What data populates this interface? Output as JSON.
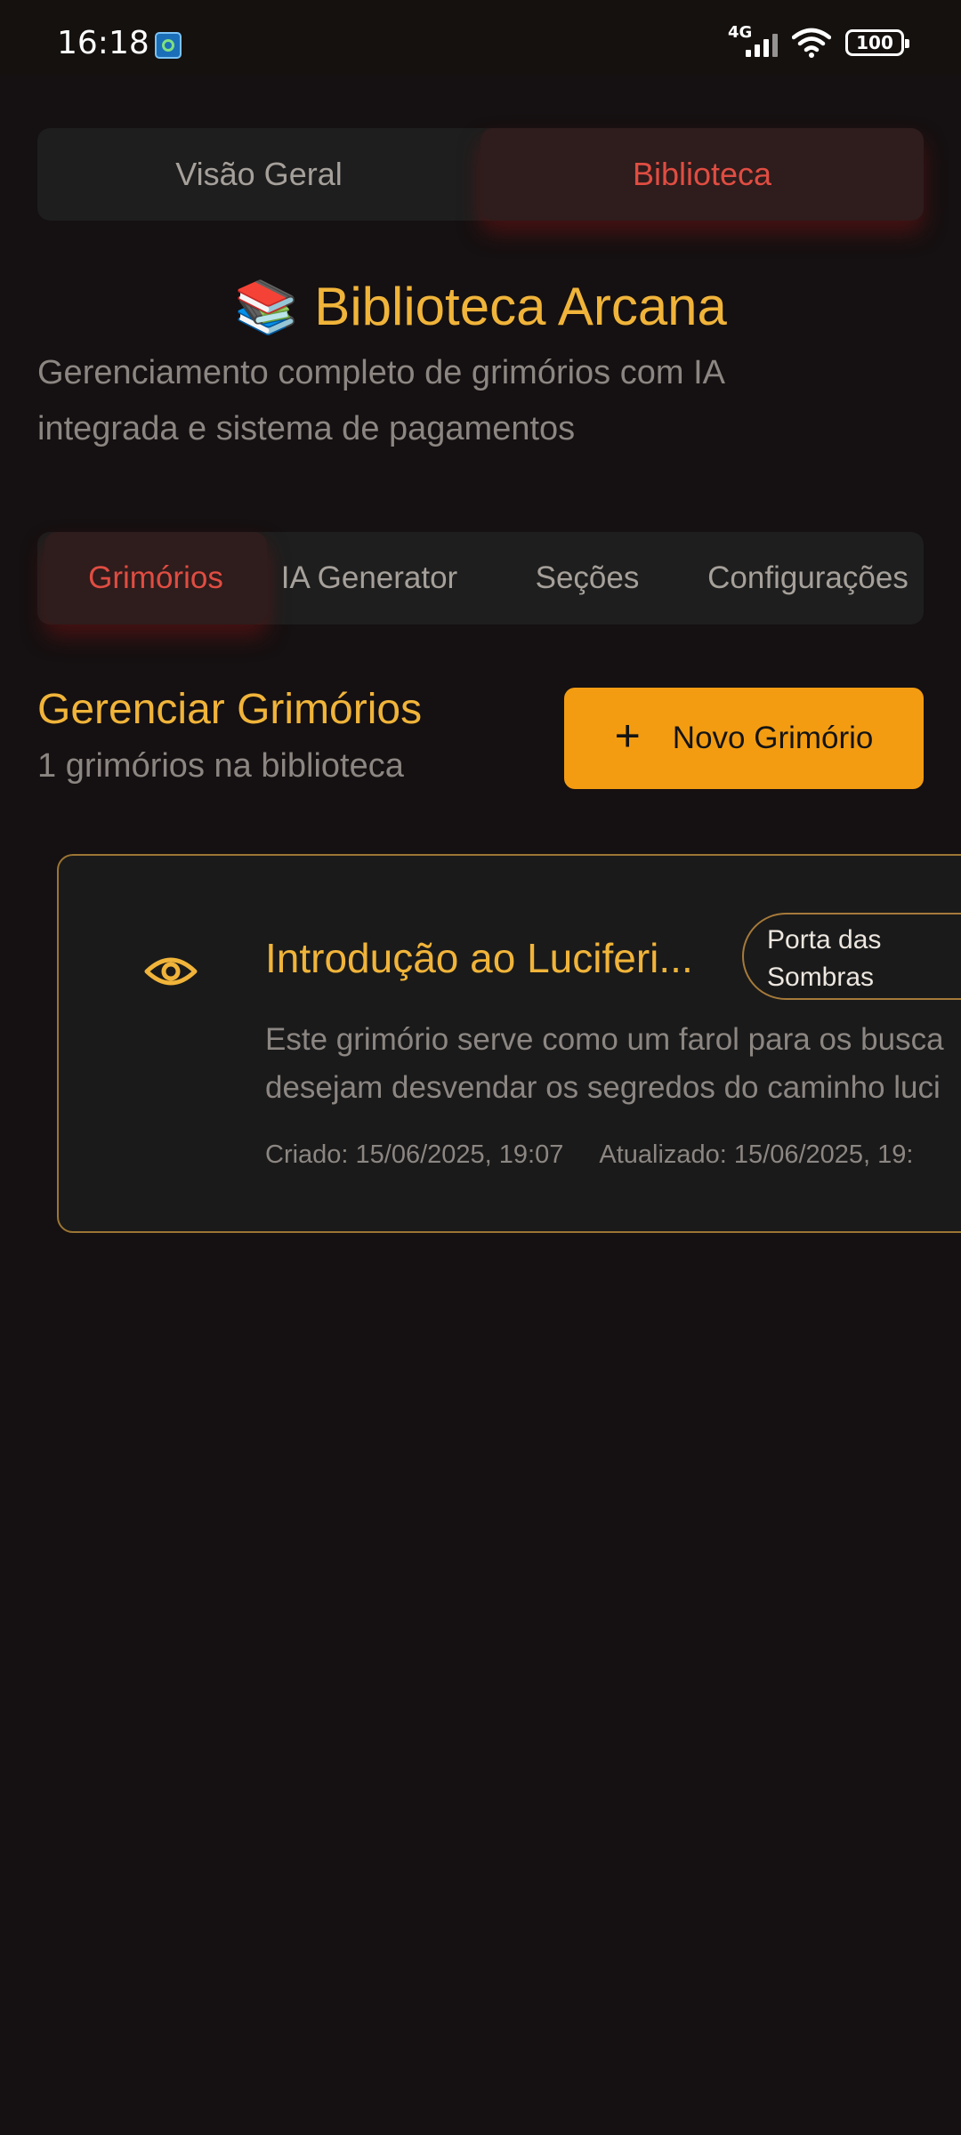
{
  "status_bar": {
    "time": "16:18",
    "network": "4G",
    "battery": "100"
  },
  "top_nav": {
    "tabs": [
      {
        "label": "Visão Geral",
        "active": false
      },
      {
        "label": "Biblioteca",
        "active": true
      }
    ]
  },
  "header": {
    "icon": "📚",
    "title": "Biblioteca Arcana",
    "subtitle_line1": "Gerenciamento completo de grimórios com IA",
    "subtitle_line2": "integrada e sistema de pagamentos"
  },
  "sub_tabs": [
    {
      "label": "Grimórios",
      "active": true
    },
    {
      "label": "IA Generator",
      "active": false
    },
    {
      "label": "Seções",
      "active": false
    },
    {
      "label": "Configurações",
      "active": false
    }
  ],
  "section": {
    "title": "Gerenciar Grimórios",
    "count_text": "1 grimórios na biblioteca",
    "new_button": "Novo Grimório"
  },
  "grimoires": [
    {
      "title": "Introdução ao Luciferi...",
      "badge_line1": "Porta das",
      "badge_line2": "Sombras",
      "desc_line1": "Este grimório serve como um farol para os busca",
      "desc_line2": "desejam desvendar os segredos do caminho luci",
      "created": "Criado: 15/06/2025, 19:07",
      "updated": "Atualizado: 15/06/2025, 19:"
    }
  ],
  "colors": {
    "background": "#151011",
    "accent_gold": "#f0b43a",
    "active_red": "#e04d42",
    "button_orange": "#f39c12",
    "card_border": "#9c7534"
  }
}
